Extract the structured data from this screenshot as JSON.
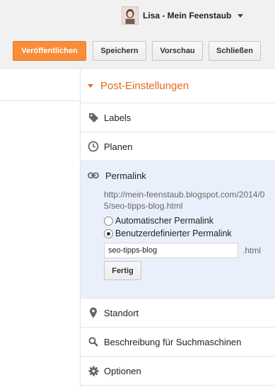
{
  "user": {
    "name": "Lisa - Mein Feenstaub",
    "avatar_icon": "user-avatar",
    "menu_icon": "caret-down-icon"
  },
  "toolbar": {
    "publish_label": "Veröffentlichen",
    "save_label": "Speichern",
    "preview_label": "Vorschau",
    "close_label": "Schließen",
    "accent_color": "#f98d3a"
  },
  "settings": {
    "title": "Post-Einstellungen",
    "title_color": "#e66a1f",
    "items": [
      {
        "label": "Labels",
        "icon": "tag-icon"
      },
      {
        "label": "Planen",
        "icon": "clock-icon"
      },
      {
        "label": "Standort",
        "icon": "map-pin-icon"
      },
      {
        "label": "Beschreibung für Suchmaschinen",
        "icon": "search-icon"
      },
      {
        "label": "Optionen",
        "icon": "gear-icon"
      }
    ]
  },
  "permalink": {
    "label": "Permalink",
    "icon": "link-icon",
    "url": "http://mein-feenstaub.blogspot.com/2014/05/seo-tipps-blog.html",
    "options": [
      {
        "label": "Automatischer Permalink",
        "selected": false
      },
      {
        "label": "Benutzerdefinierter Permalink",
        "selected": true
      }
    ],
    "custom_value": "seo-tipps-blog",
    "suffix": ".html",
    "done_label": "Fertig",
    "background_color": "#eaf0fb"
  }
}
